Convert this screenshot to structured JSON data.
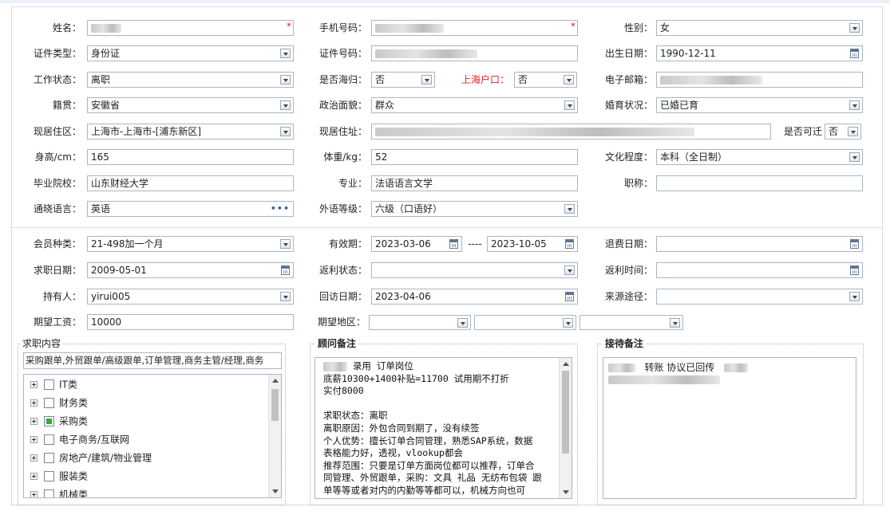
{
  "labels": {
    "name": "姓名：",
    "phone": "手机号码：",
    "gender": "性别：",
    "id_type": "证件类型：",
    "id_number": "证件号码：",
    "birth_date": "出生日期：",
    "work_status": "工作状态：",
    "returnee": "是否海归：",
    "shanghai_hukou": "上海户口：",
    "email": "电子邮箱：",
    "native_place": "籍贯：",
    "political": "政治面貌：",
    "marital": "婚育状况：",
    "residence_area": "现居住区：",
    "residence_address": "现居住址：",
    "relocate": "是否可迁",
    "height": "身高/cm：",
    "weight": "体重/kg：",
    "education": "文化程度：",
    "school": "毕业院校：",
    "major": "专业：",
    "title": "职称：",
    "language": "通晓语言：",
    "language_level": "外语等级：",
    "member_type": "会员种类：",
    "valid_period": "有效期：",
    "valid_sep": "----",
    "refund_date": "退费日期：",
    "job_seek_date": "求职日期：",
    "rebate_status": "返利状态：",
    "rebate_time": "返利时间：",
    "holder": "持有人：",
    "revisit_date": "回访日期：",
    "source": "来源途径：",
    "expected_salary": "期望工资：",
    "expected_area": "期望地区："
  },
  "values": {
    "gender": "女",
    "id_type": "身份证",
    "birth_date": "1990-12-11",
    "work_status": "离职",
    "returnee": "否",
    "shanghai_hukou": "否",
    "native_place": "安徽省",
    "political": "群众",
    "marital": "已婚已育",
    "residence_area": "上海市-上海市-[浦东新区]",
    "relocate": "否",
    "height": "165",
    "weight": "52",
    "education": "本科（全日制）",
    "school": "山东财经大学",
    "major": "法语语言文学",
    "title": "",
    "language": "英语",
    "language_level": "六级（口语好）",
    "member_type": "21-498加一个月",
    "valid_from": "2023-03-06",
    "valid_to": "2023-10-05",
    "refund_date": "",
    "job_seek_date": "2009-05-01",
    "rebate_status": "",
    "rebate_time": "",
    "holder": "yirui005",
    "revisit_date": "2023-04-06",
    "source": "",
    "expected_salary": "10000",
    "expected_area_1": "",
    "expected_area_2": "",
    "expected_area_3": ""
  },
  "required_mark": "*",
  "language_picker": "•••",
  "job_content": {
    "legend": "求职内容",
    "selected_text": "采购跟单,外贸跟单/高级跟单,订单管理,商务主管/经理,商务",
    "tree": [
      {
        "label": "IT类",
        "state": "unchecked"
      },
      {
        "label": "财务类",
        "state": "unchecked"
      },
      {
        "label": "采购类",
        "state": "partial"
      },
      {
        "label": "电子商务/互联网",
        "state": "unchecked"
      },
      {
        "label": "房地产/建筑/物业管理",
        "state": "unchecked"
      },
      {
        "label": "服装类",
        "state": "unchecked"
      },
      {
        "label": "机械类",
        "state": "unchecked"
      }
    ]
  },
  "consultant_notes": {
    "legend": "顾问备注",
    "line1_suffix": "录用 订单岗位",
    "body": "底薪10300+1400补贴=11700 试用期不打折\n实付8000\n\n求职状态：离职\n离职原因：外包合同到期了，没有续签\n个人优势：擅长订单合同管理，熟悉SAP系统，数据\n表格能力好，透视，vlookup都会\n推荐范围：只要是订单方面岗位都可以推荐，订单合\n同管理、外贸跟单，采购：文具 礼品 无纺布包袋 跟\n单等等或者对内的内勤等等都可以，机械方向也可\n以，CAD可以看懂；不考虑销售营销形式的，外包合"
  },
  "reception_notes": {
    "legend": "接待备注",
    "text": "转账 协议已回传"
  }
}
